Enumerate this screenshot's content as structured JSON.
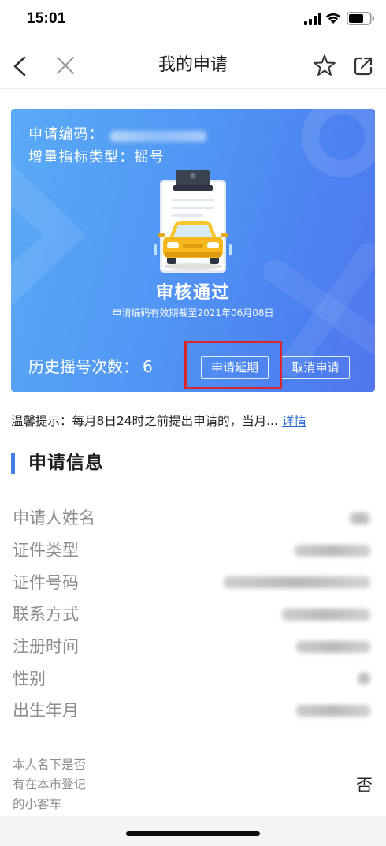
{
  "status_bar": {
    "time": "15:01",
    "battery_level": 0.72,
    "icons": [
      "signal-icon",
      "wifi-icon",
      "battery-icon"
    ]
  },
  "nav": {
    "title": "我的申请",
    "icons": {
      "back": "back-arrow-icon",
      "close": "close-icon",
      "favorite": "star-icon",
      "share": "share-icon"
    }
  },
  "card": {
    "code_label": "申请编码：",
    "type_label": "增量指标类型：",
    "type_value": "摇号",
    "status": "审核通过",
    "validity": "申请编码有效期截至2021年06月08日",
    "history_label": "历史摇号次数：",
    "history_count": "6",
    "extend_button": "申请延期",
    "cancel_button": "取消申请"
  },
  "tip": {
    "text": "温馨提示：每月8日24时之前提出申请的，当月...",
    "link": "详情"
  },
  "section": {
    "title": "申请信息"
  },
  "info_rows": [
    {
      "label": "申请人姓名"
    },
    {
      "label": "证件类型"
    },
    {
      "label": "证件号码"
    },
    {
      "label": "联系方式"
    },
    {
      "label": "注册时间"
    },
    {
      "label": "性别"
    },
    {
      "label": "出生年月"
    }
  ],
  "vehicle_row": {
    "label_lines": [
      "本人名下是否",
      "有在本市登记",
      "的小客车"
    ],
    "value": "否"
  },
  "colors": {
    "card_start": "#5aabf7",
    "card_end": "#4c80f0",
    "highlight": "#d7262c",
    "link": "#2d6cd9",
    "section_bar": "#3f80ea",
    "label": "#8e8e8e",
    "car": "#f6b81d"
  }
}
